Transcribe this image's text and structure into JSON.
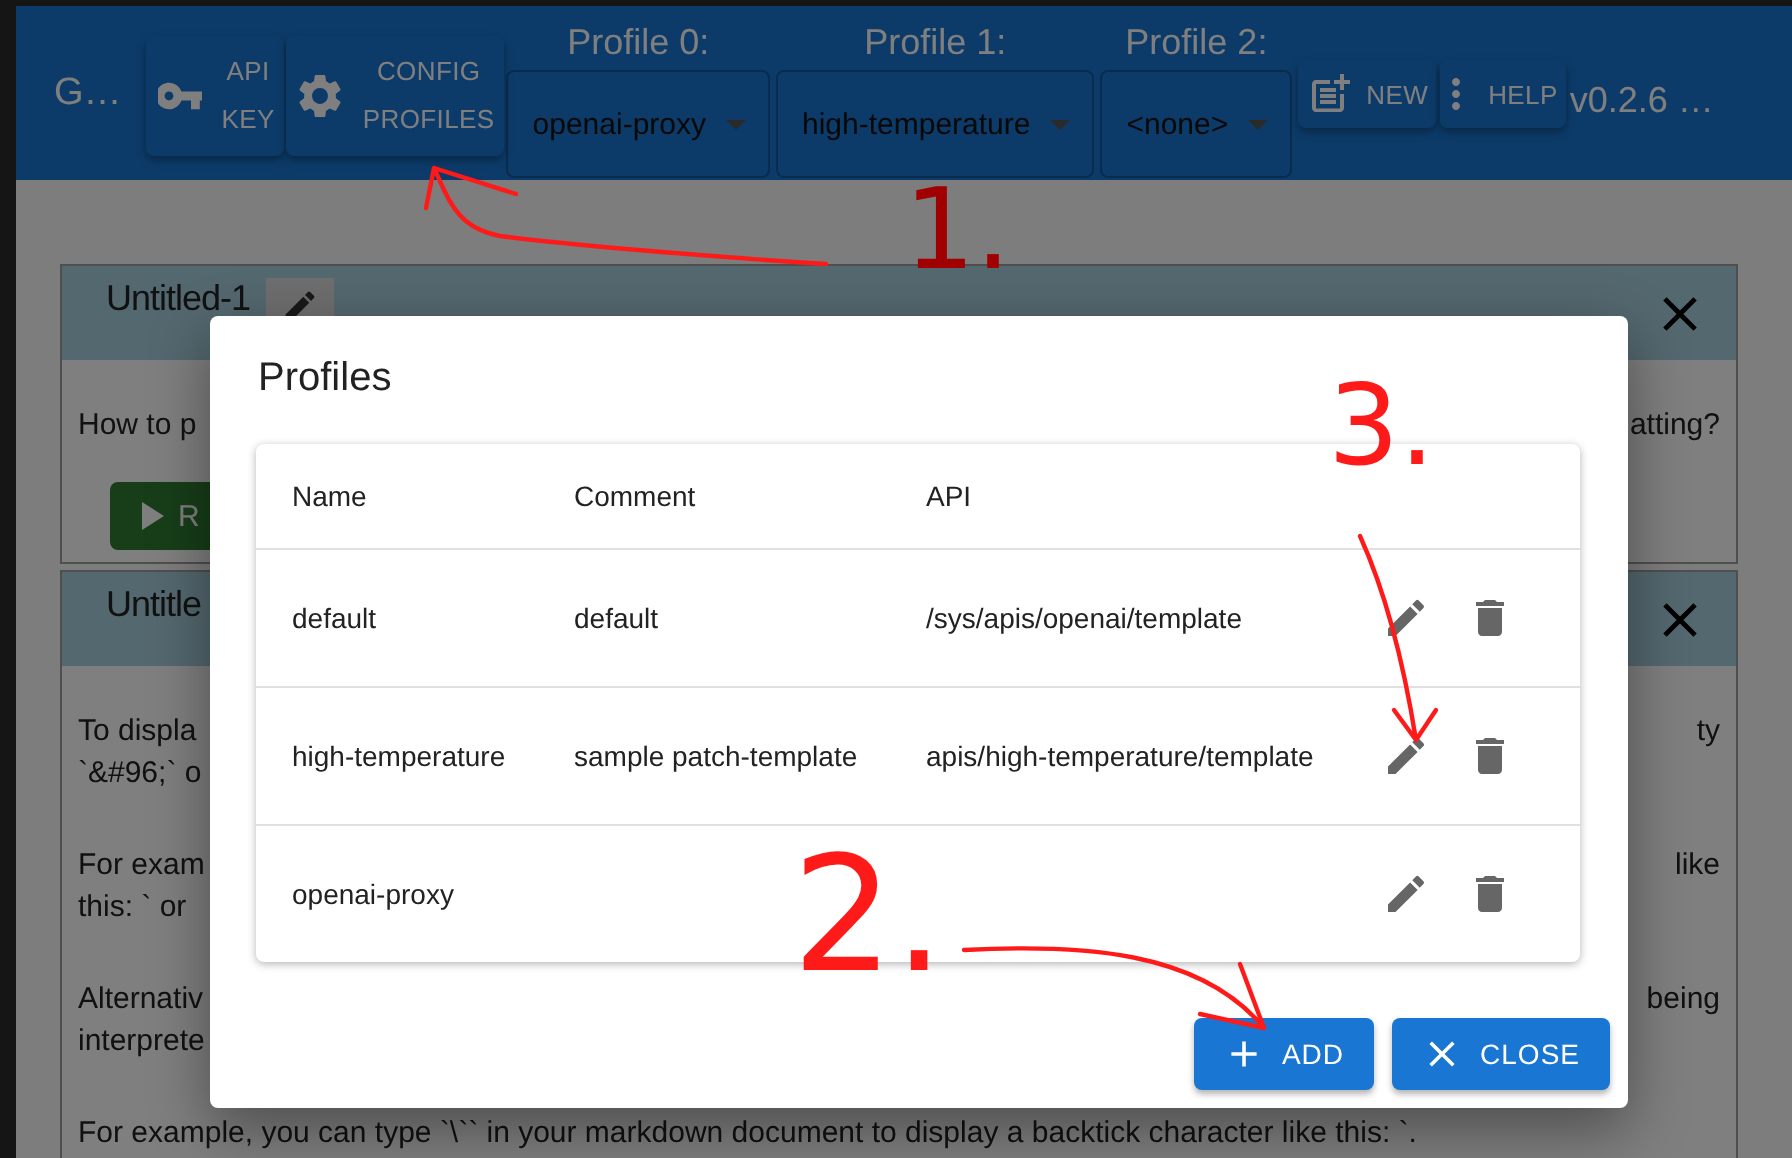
{
  "app_bar": {
    "title": "G…",
    "tools": [
      {
        "kind": "key",
        "label": "API KEY"
      },
      {
        "kind": "gear",
        "label": "CONFIG PROFILES"
      }
    ],
    "profiles": [
      {
        "label": "Profile 0:",
        "value": "openai-proxy"
      },
      {
        "label": "Profile 1:",
        "value": "high-temperature"
      },
      {
        "label": "Profile 2:",
        "value": "<none>"
      }
    ],
    "actions": [
      {
        "kind": "new",
        "label": "NEW"
      },
      {
        "kind": "help",
        "label": "HELP"
      }
    ],
    "version": "v0.2.6 …"
  },
  "panels": [
    {
      "title": "Untitled-1",
      "lines": [
        {
          "left": "How to p",
          "right": "atting?"
        }
      ],
      "run_label": "R"
    },
    {
      "title": "Untitle",
      "paragraphs": [
        [
          {
            "left": "To displa",
            "right": "ty"
          },
          {
            "left": "`&#96;` o"
          }
        ],
        [
          {
            "left": "For exam",
            "right": "like"
          },
          {
            "left": "this: ` or"
          }
        ],
        [
          {
            "left": "Alternativ",
            "right": "being"
          },
          {
            "left": "interprete"
          }
        ],
        [
          {
            "left": "For example, you can type `\\`` in your markdown document to display a backtick character like this: `."
          }
        ]
      ]
    }
  ],
  "dialog": {
    "title": "Profiles",
    "columns": [
      "Name",
      "Comment",
      "API"
    ],
    "rows": [
      {
        "name": "default",
        "comment": "default",
        "api": "/sys/apis/openai/template"
      },
      {
        "name": "high-temperature",
        "comment": "sample patch-template",
        "api": "apis/high-temperature/template"
      },
      {
        "name": "openai-proxy"
      }
    ],
    "buttons": [
      {
        "kind": "add",
        "label": "ADD"
      },
      {
        "kind": "close",
        "label": "CLOSE"
      }
    ]
  },
  "annotations": [
    "1.",
    "2.",
    "3."
  ]
}
